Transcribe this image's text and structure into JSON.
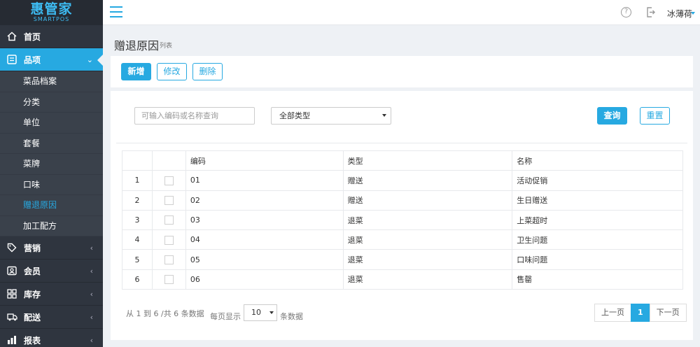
{
  "brand": {
    "name": "惠管家",
    "sub": "SMARTPOS"
  },
  "sidebar": {
    "items": [
      {
        "label": "首页",
        "icon": "home-icon"
      },
      {
        "label": "品项",
        "icon": "list-icon",
        "active": true
      },
      {
        "label": "营销",
        "icon": "tag-icon"
      },
      {
        "label": "会员",
        "icon": "member-card-icon"
      },
      {
        "label": "库存",
        "icon": "grid-icon"
      },
      {
        "label": "配送",
        "icon": "truck-icon"
      },
      {
        "label": "报表",
        "icon": "report-icon"
      }
    ],
    "sub_items": [
      "菜品档案",
      "分类",
      "单位",
      "套餐",
      "菜牌",
      "口味",
      "赠退原因",
      "加工配方"
    ],
    "current_sub": "赠退原因"
  },
  "header": {
    "user": "冰薄荷"
  },
  "page": {
    "title": "赠退原因",
    "subtitle": "列表"
  },
  "toolbar": {
    "add": "新增",
    "edit": "修改",
    "delete": "删除"
  },
  "search": {
    "placeholder": "可输入编码或名称查询",
    "type_value": "全部类型",
    "query": "查询",
    "reset": "重置"
  },
  "table": {
    "headers": [
      "编码",
      "类型",
      "名称"
    ],
    "rows": [
      {
        "no": "1",
        "code": "01",
        "type": "赠送",
        "name": "活动促销"
      },
      {
        "no": "2",
        "code": "02",
        "type": "赠送",
        "name": "生日赠送"
      },
      {
        "no": "3",
        "code": "03",
        "type": "退菜",
        "name": "上菜超时"
      },
      {
        "no": "4",
        "code": "04",
        "type": "退菜",
        "name": "卫生问题"
      },
      {
        "no": "5",
        "code": "05",
        "type": "退菜",
        "name": "口味问题"
      },
      {
        "no": "6",
        "code": "06",
        "type": "退菜",
        "name": "售罄"
      }
    ]
  },
  "pager": {
    "info": "从 1 到 6 /共 6 条数据",
    "per_page_label": "每页显示",
    "per_page": "10",
    "per_page_suffix": "条数据",
    "prev": "上一页",
    "current": "1",
    "next": "下一页"
  },
  "colors": {
    "accent": "#27a9e1",
    "sidebar_bg": "#2f353f"
  }
}
